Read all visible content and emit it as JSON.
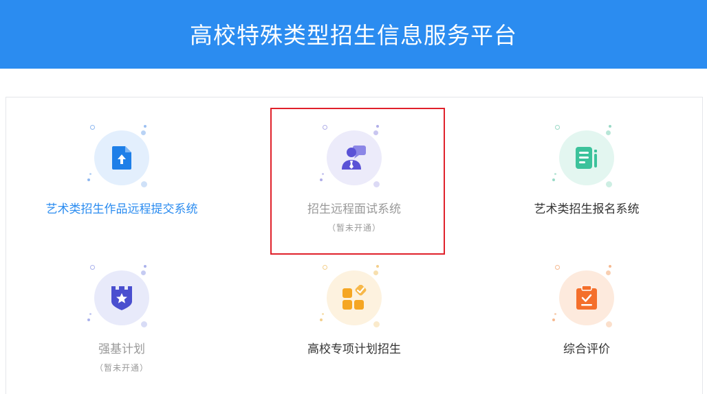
{
  "header": {
    "title": "高校特殊类型招生信息服务平台"
  },
  "cards": [
    {
      "title": "艺术类招生作品远程提交系统",
      "note": "",
      "icon": "upload-file-icon"
    },
    {
      "title": "招生远程面试系统",
      "note": "（暂未开通）",
      "icon": "interview-user-icon"
    },
    {
      "title": "艺术类招生报名系统",
      "note": "",
      "icon": "form-document-icon"
    },
    {
      "title": "强基计划",
      "note": "（暂未开通）",
      "icon": "shield-star-icon"
    },
    {
      "title": "高校专项计划招生",
      "note": "",
      "icon": "grid-check-icon"
    },
    {
      "title": "综合评价",
      "note": "",
      "icon": "clipboard-check-icon"
    }
  ],
  "colors": {
    "header_bg": "#2b8cf0",
    "link_blue": "#2b8cf0",
    "disabled_text": "#999999",
    "normal_text": "#333333",
    "highlight_border": "#e0202a"
  }
}
